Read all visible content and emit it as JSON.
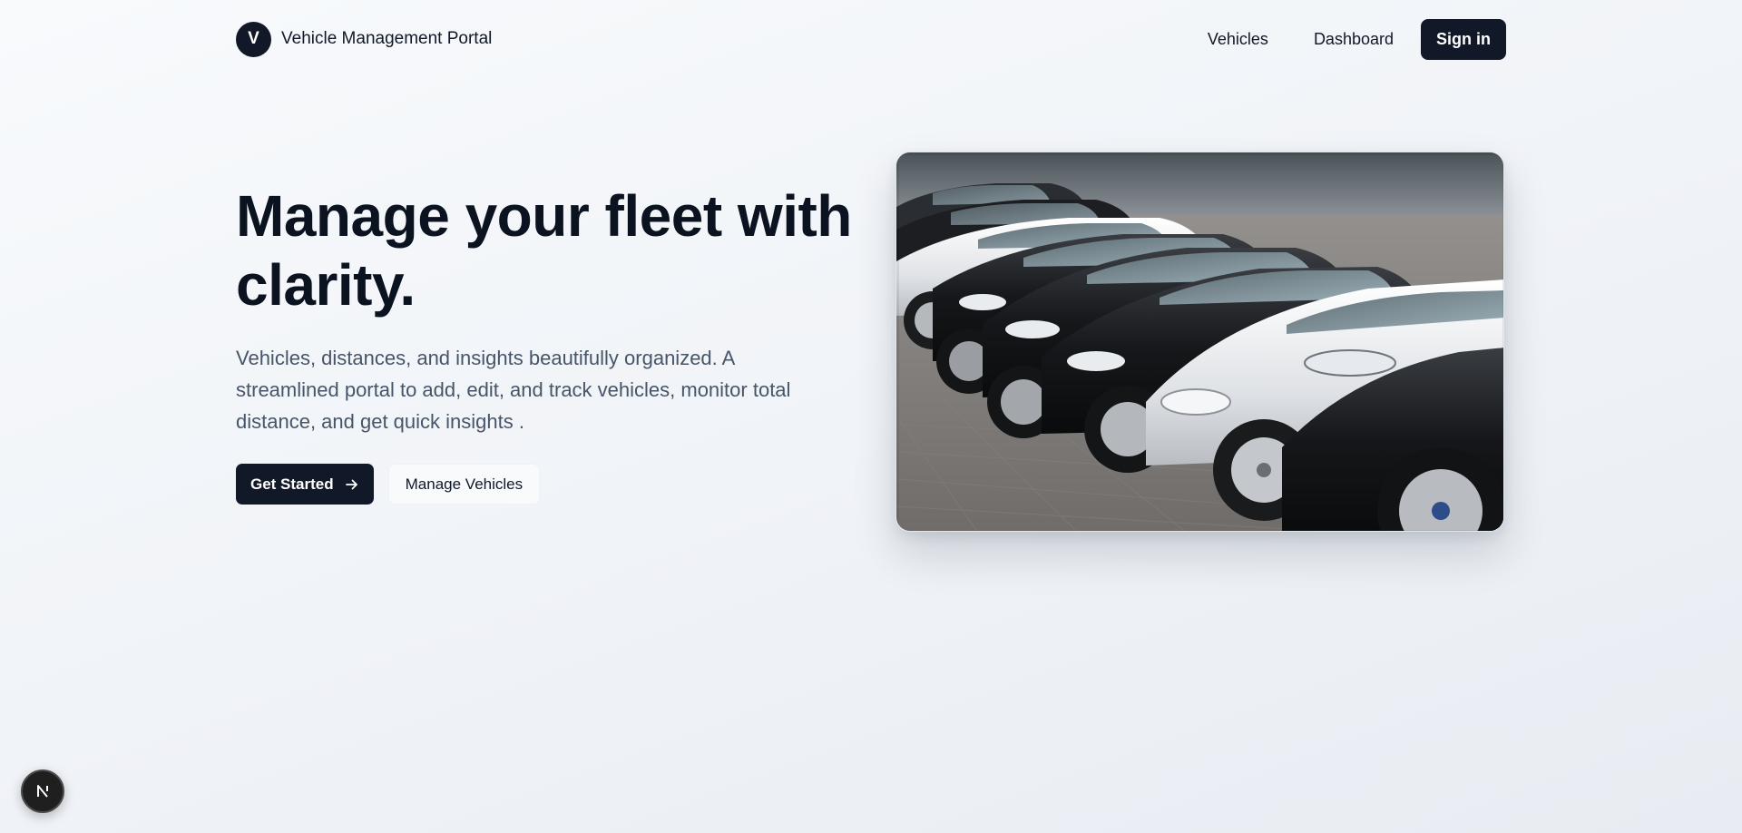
{
  "header": {
    "logo_letter": "V",
    "brand_name": "Vehicle Management Portal",
    "nav": [
      {
        "label": "Vehicles"
      },
      {
        "label": "Dashboard"
      }
    ],
    "signin_label": "Sign in"
  },
  "hero": {
    "title": "Manage your fleet with clarity.",
    "subtitle": "Vehicles, distances, and insights beautifully organized. A streamlined portal to add, edit, and track vehicles, monitor total distance, and get quick insights .",
    "primary_button": "Get Started",
    "primary_icon": "arrow-right-icon",
    "secondary_button": "Manage Vehicles",
    "image_subject": "row-of-parked-cars-photo"
  },
  "badge": {
    "icon": "nextjs-icon"
  },
  "colors": {
    "primary": "#111827",
    "heading": "#0b1220",
    "muted_text": "#475569",
    "background": "#f1f4f8"
  }
}
